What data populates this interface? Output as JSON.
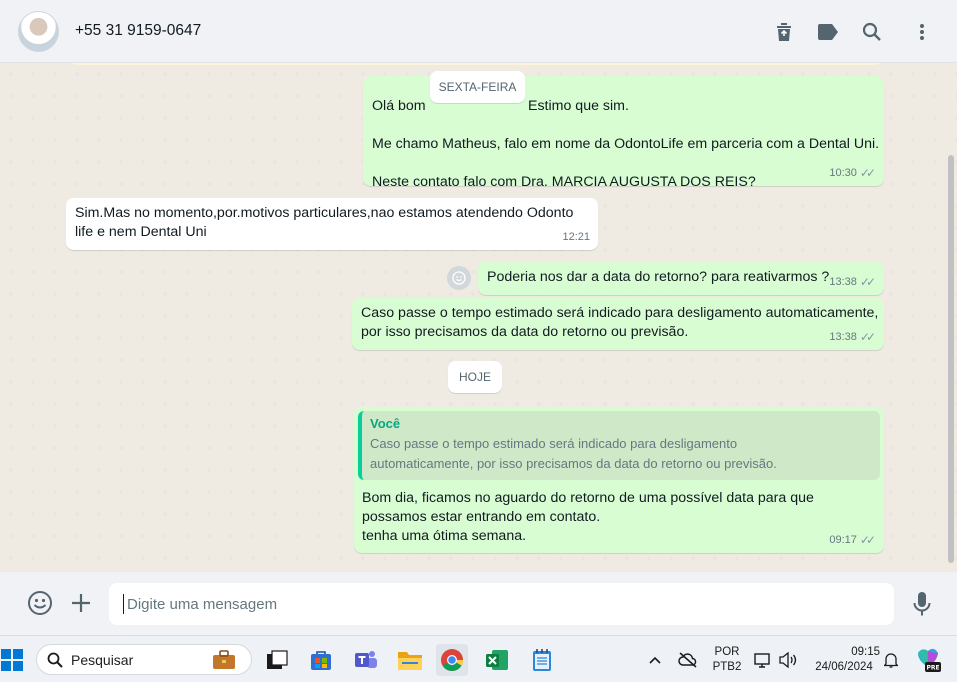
{
  "header": {
    "contact_name": "+55 31 9159-0647",
    "icons": [
      "avatar",
      "trash-icon",
      "label-icon",
      "search-icon",
      "more-icon"
    ]
  },
  "chat": {
    "messages": [
      {
        "direction": "out",
        "lines": "Olá bom dia. Estimo que sim.\n\nMe chamo Matheus, falo em nome da OdontoLife em parceria com a Dental Uni.\n\nNeste contato falo com Dra. MARCIA AUGUSTA DOS REIS?",
        "time": "10:30",
        "status": "read"
      },
      {
        "direction": "in",
        "lines": "Sim.Mas no momento,por.motivos particulares,nao estamos atendendo Odonto\nlife e nem Dental Uni",
        "time": "12:21"
      },
      {
        "direction": "out",
        "lines": "Poderia nos dar a data do retorno? para reativarmos ?",
        "time": "13:38",
        "status": "read"
      },
      {
        "direction": "out",
        "lines": "Caso passe o tempo estimado será indicado para desligamento automaticamente,\npor isso precisamos da data do retorno ou previsão.",
        "time": "13:38",
        "status": "read"
      },
      {
        "direction": "out",
        "quote_author": "Você",
        "quote_text": "Caso passe o tempo estimado será indicado para desligamento\nautomaticamente, por isso precisamos da data do retorno ou previsão.",
        "lines": "Bom dia, ficamos no aguardo do retorno de uma possível data para que\npossamos estar entrando em contato.\ntenha uma ótima semana.",
        "time": "09:17",
        "status": "read"
      }
    ],
    "date_separators": [
      "SEXTA-FEIRA",
      "HOJE"
    ],
    "first_message_visible_prefix": "Olá bom",
    "first_message_visible_suffix": "Estimo que sim."
  },
  "compose": {
    "placeholder": "Digite uma mensagem",
    "icons": [
      "emoji-icon",
      "plus-icon",
      "mic-icon"
    ]
  },
  "taskbar": {
    "search_placeholder": "Pesquisar",
    "language_line1": "POR",
    "language_line2": "PTB2",
    "time": "09:15",
    "date": "24/06/2024",
    "apps": [
      "windows-start",
      "task-view",
      "microsoft-store",
      "teams",
      "file-explorer",
      "chrome",
      "excel",
      "notepad"
    ],
    "copilot_badge": "PRE",
    "colors": {
      "accent": "#0078d4"
    }
  },
  "colors": {
    "outgoing_bubble": "#d9fdd3",
    "incoming_bubble": "#ffffff",
    "chat_background": "#efeae2",
    "quote_accent": "#06cf9c"
  }
}
